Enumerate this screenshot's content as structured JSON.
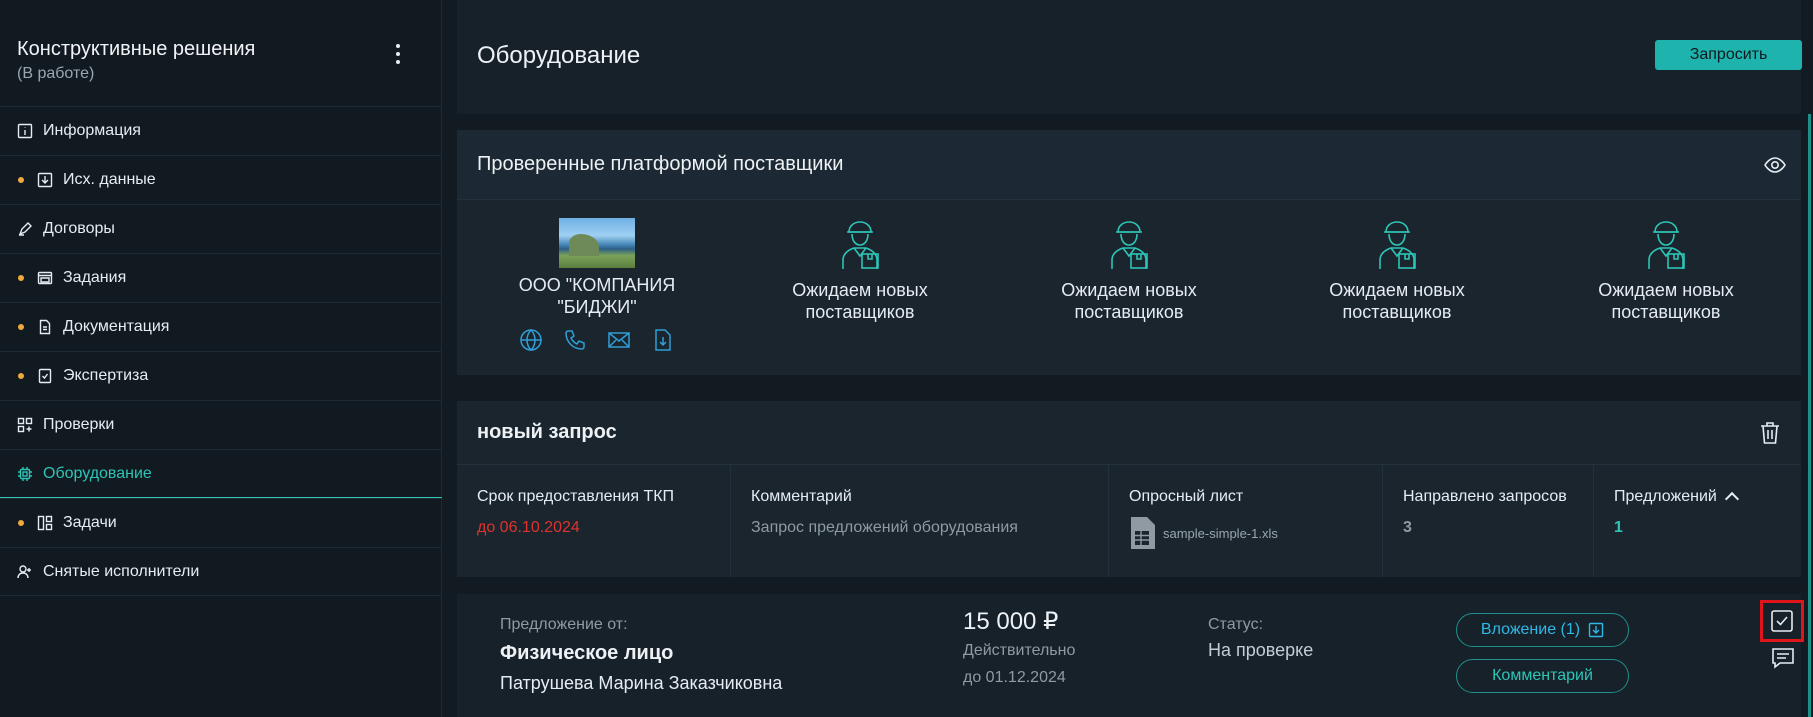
{
  "sidebar": {
    "project_title": "Конструктивные решения",
    "project_status": "(В работе)",
    "items": [
      {
        "label": "Информация",
        "icon": "info-icon",
        "dot": false,
        "active": false
      },
      {
        "label": "Исх. данные",
        "icon": "download-icon",
        "dot": true,
        "active": false
      },
      {
        "label": "Договоры",
        "icon": "pen-icon",
        "dot": false,
        "active": false
      },
      {
        "label": "Задания",
        "icon": "window-icon",
        "dot": true,
        "active": false
      },
      {
        "label": "Документация",
        "icon": "document-icon",
        "dot": true,
        "active": false
      },
      {
        "label": "Экспертиза",
        "icon": "checklist-icon",
        "dot": true,
        "active": false
      },
      {
        "label": "Проверки",
        "icon": "grid-icon",
        "dot": false,
        "active": false
      },
      {
        "label": "Оборудование",
        "icon": "chip-icon",
        "dot": false,
        "active": true
      },
      {
        "label": "Задачи",
        "icon": "layout-icon",
        "dot": true,
        "active": false
      },
      {
        "label": "Снятые исполнители",
        "icon": "user-plus-icon",
        "dot": false,
        "active": false
      }
    ]
  },
  "header": {
    "title": "Оборудование",
    "request_button": "Запросить"
  },
  "suppliers": {
    "title": "Проверенные платформой поставщики",
    "list": [
      {
        "name": "ООО \"КОМПАНИЯ \"БИДЖИ\"",
        "has_photo": true
      },
      {
        "name": "Ожидаем новых поставщиков",
        "has_photo": false
      },
      {
        "name": "Ожидаем новых поставщиков",
        "has_photo": false
      },
      {
        "name": "Ожидаем новых поставщиков",
        "has_photo": false
      },
      {
        "name": "Ожидаем новых поставщиков",
        "has_photo": false
      }
    ],
    "contact_icons": [
      "globe-icon",
      "phone-icon",
      "mail-icon",
      "file-download-icon"
    ]
  },
  "request": {
    "title": "новый запрос",
    "deadline_label": "Срок предоставления ТКП",
    "deadline_value": "до 06.10.2024",
    "comment_label": "Комментарий",
    "comment_value": "Запрос предложений оборудования",
    "questionnaire_label": "Опросный лист",
    "questionnaire_file": "sample-simple-1.xls",
    "sent_label": "Направлено запросов",
    "sent_value": "3",
    "offers_label": "Предложений",
    "offers_value": "1"
  },
  "offer": {
    "from_label": "Предложение от:",
    "from_type": "Физическое лицо",
    "from_name": "Патрушева Марина Заказчиковна",
    "price": "15 000 ₽",
    "valid_label": "Действительно",
    "valid_until": "до 01.12.2024",
    "status_label": "Статус:",
    "status_value": "На проверке",
    "attachment_button": "Вложение (1)",
    "comment_button": "Комментарий"
  },
  "colors": {
    "accent": "#2ec4b6",
    "button": "#1eb3ad",
    "deadline": "#e0322d",
    "dot": "#f2a93b",
    "highlight_border": "#e0141b"
  }
}
